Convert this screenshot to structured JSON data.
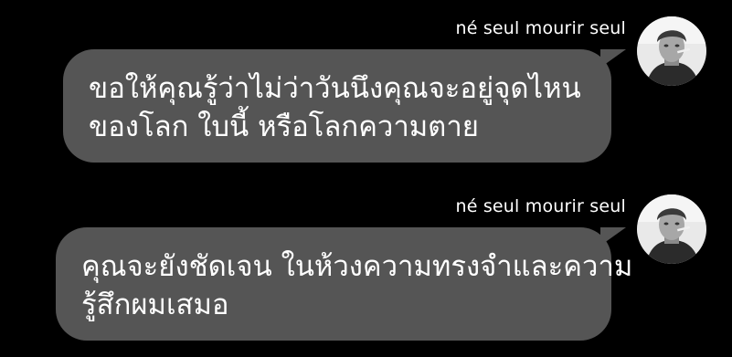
{
  "chat": {
    "messages": [
      {
        "sender": "né seul mourir seul",
        "lines": [
          "ขอให้คุณรู้ว่าไม่ว่าวันนึงคุณจะอยู่จุดไหน",
          "ของโลก ใบนี้ หรือโลกความตาย"
        ]
      },
      {
        "sender": "né seul mourir seul",
        "lines": [
          "คุณจะยังชัดเจน ในห้วงความทรงจำและความ",
          "รู้สึกผมเสมอ"
        ]
      }
    ]
  },
  "colors": {
    "background": "#000000",
    "bubble": "#555555",
    "text": "#ffffff"
  },
  "icons": {
    "avatar": "profile-photo"
  }
}
